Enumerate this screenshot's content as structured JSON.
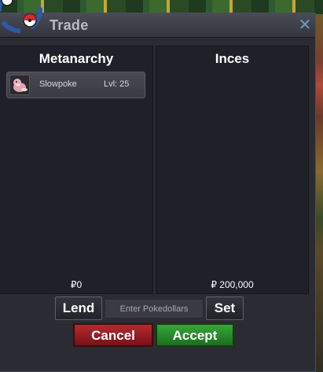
{
  "window": {
    "title": "Trade",
    "close_icon": "close-icon"
  },
  "left_panel": {
    "player_name": "Metanarchy",
    "money": "₽0",
    "items": [
      {
        "icon": "slowpoke-icon",
        "name": "Slowpoke",
        "level": "Lvl: 25"
      }
    ]
  },
  "right_panel": {
    "player_name": "Inces",
    "money": "₽ 200,000"
  },
  "controls": {
    "lend_label": "Lend",
    "money_placeholder": "Enter Pokedollars",
    "set_label": "Set",
    "cancel_label": "Cancel",
    "accept_label": "Accept"
  },
  "colors": {
    "accent_blue": "#6a9ad6",
    "cancel_red": "#b42a30",
    "accept_green": "#34a838"
  }
}
